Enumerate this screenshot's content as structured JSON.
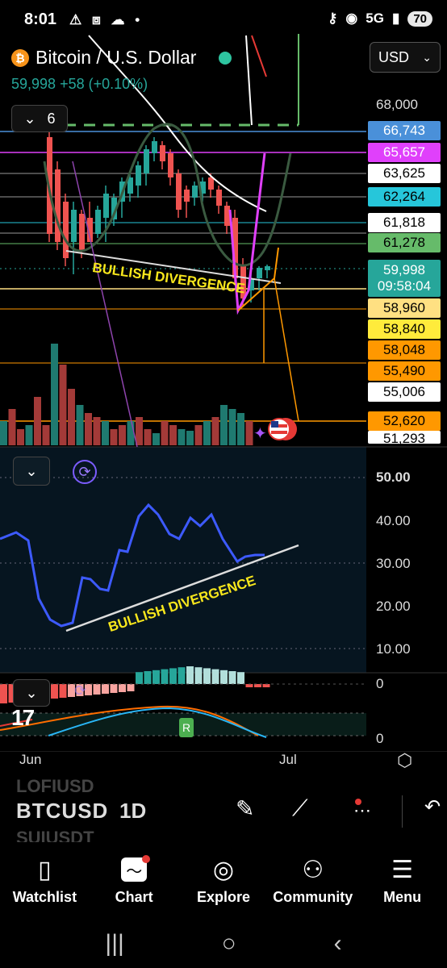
{
  "status_bar": {
    "time": "8:01",
    "left_icons": [
      "alert-icon",
      "screenshot-icon",
      "cloud-icon",
      "dot-icon"
    ],
    "network": "5G",
    "battery": "70"
  },
  "header": {
    "symbol_title": "Bitcoin / U.S. Dollar",
    "last_price": "59,998",
    "change": "+58",
    "change_pct": "(+0.10%)",
    "indicators_count": "6",
    "currency": "USD"
  },
  "price_axis": {
    "top_tick": "68,000",
    "labels": [
      {
        "value": "66,743",
        "bg": "#4a90d9",
        "fg": "#ffffff"
      },
      {
        "value": "65,657",
        "bg": "#e040fb",
        "fg": "#ffffff"
      },
      {
        "value": "63,625",
        "bg": "#ffffff",
        "fg": "#000000"
      },
      {
        "value": "62,264",
        "bg": "#26c6da",
        "fg": "#000000"
      },
      {
        "value": "61,818",
        "bg": "#ffffff",
        "fg": "#000000"
      },
      {
        "value": "61,278",
        "bg": "#66bb6a",
        "fg": "#000000"
      },
      {
        "value": "58,960",
        "bg": "#ffe082",
        "fg": "#000000"
      },
      {
        "value": "58,840",
        "bg": "#ffeb3b",
        "fg": "#000000"
      },
      {
        "value": "58,048",
        "bg": "#ff9800",
        "fg": "#000000"
      },
      {
        "value": "55,490",
        "bg": "#ff9800",
        "fg": "#000000"
      },
      {
        "value": "55,006",
        "bg": "#ffffff",
        "fg": "#000000"
      },
      {
        "value": "52,620",
        "bg": "#ff9800",
        "fg": "#000000"
      },
      {
        "value": "51,293",
        "bg": "#ffffff",
        "fg": "#000000"
      }
    ],
    "current": {
      "price": "59,998",
      "countdown": "09:58:04",
      "bg": "#26a69a"
    }
  },
  "annotations": {
    "price_pane": "BULLISH DIVERGENCE",
    "oscillator_pane": "BULLISH DIVERGENCE"
  },
  "oscillator_axis": [
    "50.00",
    "40.00",
    "30.00",
    "20.00",
    "10.00"
  ],
  "macd_axis": [
    "0",
    "0"
  ],
  "macd_badge": "R",
  "time_axis": [
    "Jun",
    "Jul"
  ],
  "bottom_toolbar": {
    "symbol": "BTCUSD",
    "symbol_above": "LOFIUSD",
    "symbol_below": "SUIUSDT",
    "interval": "1D"
  },
  "bottom_nav": [
    {
      "label": "Watchlist",
      "icon": "bookmark-icon"
    },
    {
      "label": "Chart",
      "icon": "chart-icon"
    },
    {
      "label": "Explore",
      "icon": "compass-icon"
    },
    {
      "label": "Community",
      "icon": "people-icon"
    },
    {
      "label": "Menu",
      "icon": "hamburger-icon"
    }
  ],
  "colors": {
    "up": "#26a69a",
    "down": "#ef5350",
    "rsi": "#3d5afe",
    "annotation": "#f8e71c"
  }
}
